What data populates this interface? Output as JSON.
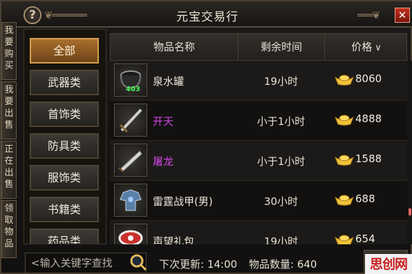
{
  "window": {
    "title": "元宝交易行",
    "help_label": "?",
    "close_label": "✕"
  },
  "side_tabs": [
    {
      "label": "我要购买"
    },
    {
      "label": "我要出售"
    },
    {
      "label": "正在出售"
    },
    {
      "label": "领取物品"
    }
  ],
  "categories": [
    {
      "label": "全部",
      "active": true
    },
    {
      "label": "武器类",
      "active": false
    },
    {
      "label": "首饰类",
      "active": false
    },
    {
      "label": "防具类",
      "active": false
    },
    {
      "label": "服饰类",
      "active": false
    },
    {
      "label": "书籍类",
      "active": false
    },
    {
      "label": "药品类",
      "active": false
    }
  ],
  "table": {
    "headers": {
      "name": "物品名称",
      "time": "剩余时间",
      "price": "价格",
      "price_sort_icon": "chevron-down-icon"
    },
    "rows": [
      {
        "icon": "water-jar-icon",
        "qty": "403",
        "name": "泉水罐",
        "name_color": "#eee8dc",
        "time": "19小时",
        "price": "8060"
      },
      {
        "icon": "sword-icon",
        "qty": "",
        "name": "开天",
        "name_color": "#d145e6",
        "time": "小于1小时",
        "price": "4888"
      },
      {
        "icon": "blade-icon",
        "qty": "",
        "name": "屠龙",
        "name_color": "#d145e6",
        "time": "小于1小时",
        "price": "1588"
      },
      {
        "icon": "armor-icon",
        "qty": "",
        "name": "雷霆战甲(男)",
        "name_color": "#eee8dc",
        "time": "30小时",
        "price": "688"
      },
      {
        "icon": "gift-box-icon",
        "qty": "",
        "name": "声望礼包",
        "name_color": "#eee8dc",
        "time": "19小时",
        "price": "654"
      }
    ],
    "currency_icon": "gold-ingot-icon"
  },
  "footer": {
    "search_placeholder": "<输入关键字查找",
    "next_refresh": "下次更新: 14:00",
    "item_count": "物品数量: 640"
  },
  "watermark": "思创网",
  "colors": {
    "accent_gold": "#d7a24f",
    "purple_item": "#d145e6",
    "qty_green": "#48ff5a",
    "close_red": "#c4311f"
  }
}
